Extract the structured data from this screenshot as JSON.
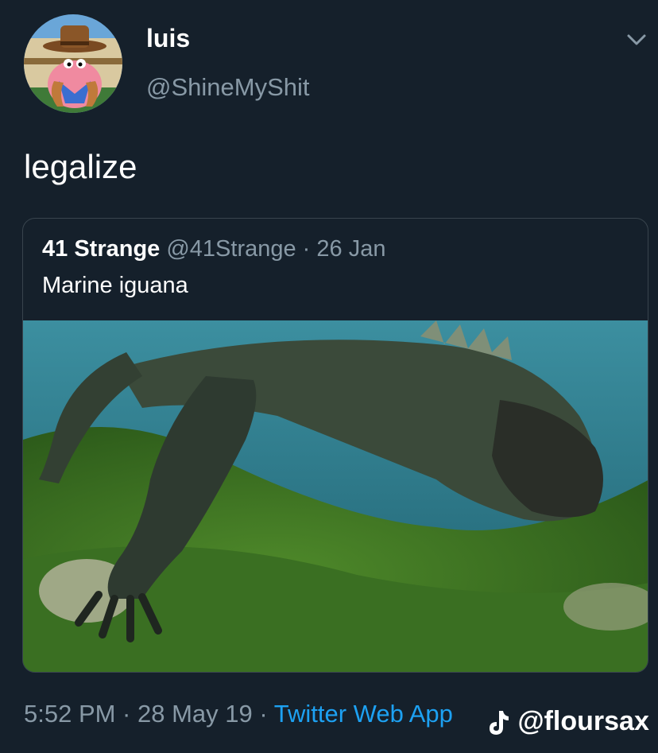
{
  "author": {
    "display_name": "luis",
    "handle": "@ShineMyShit",
    "avatar_icon": "cartoon-starfish-cowboy-avatar"
  },
  "tweet": {
    "text": "legalize",
    "timestamp": "5:52 PM · 28 May 19 · ",
    "source": "Twitter Web App"
  },
  "quoted_tweet": {
    "display_name": "41 Strange",
    "meta": " @41Strange · 26 Jan",
    "text": "Marine iguana",
    "image_subject": "marine-iguana-underwater-photo"
  },
  "watermark": {
    "text": "@floursax",
    "icon": "tiktok-icon"
  },
  "colors": {
    "background": "#15202b",
    "secondary_text": "#8899a6",
    "link": "#1da1f2",
    "border": "#38444d"
  }
}
